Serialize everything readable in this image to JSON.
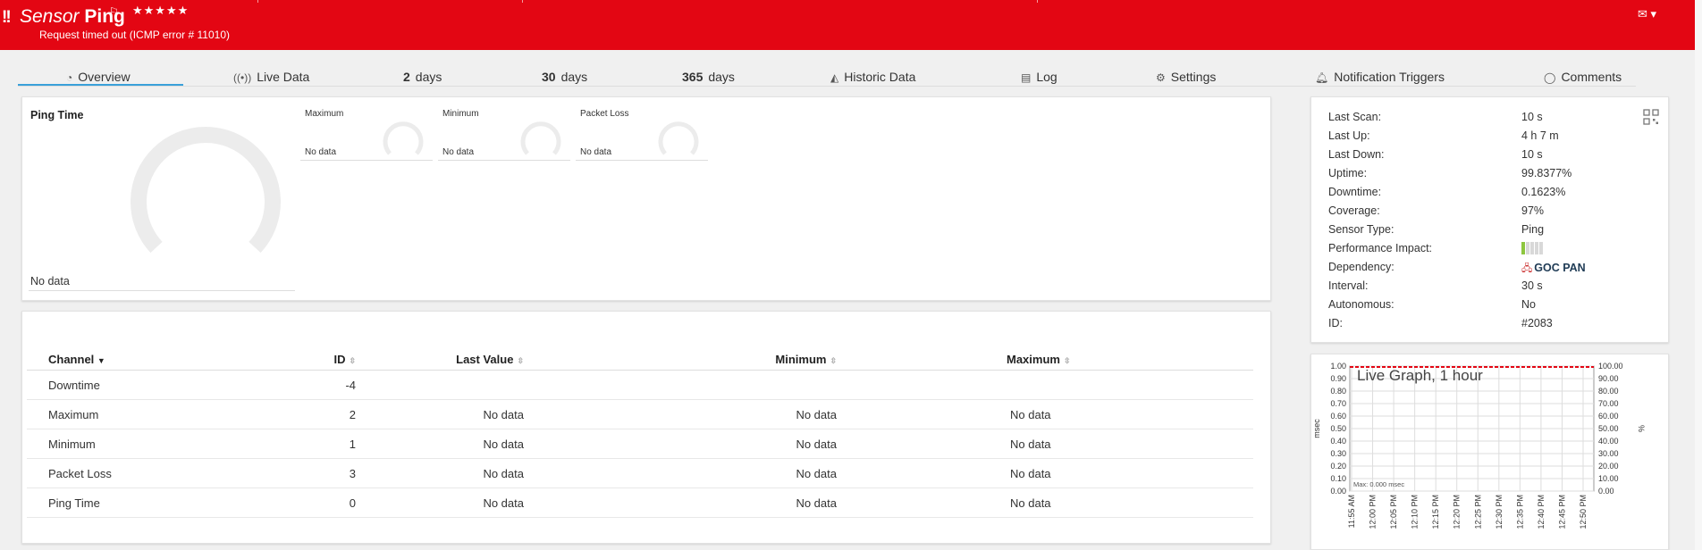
{
  "header": {
    "sensor_word": "Sensor",
    "name": "Ping",
    "stars": "★★★★★",
    "status_message": "Request timed out (ICMP error # 11010)",
    "mail_icon": "envelope-icon",
    "bg_color": "#e30613"
  },
  "tabs": [
    {
      "icon": "gauge-icon",
      "label": "Overview",
      "active": true
    },
    {
      "icon": "broadcast-icon",
      "label": "Live Data"
    },
    {
      "number": "2",
      "label": "days"
    },
    {
      "number": "30",
      "label": "days"
    },
    {
      "number": "365",
      "label": "days"
    },
    {
      "icon": "area-chart-icon",
      "label": "Historic Data"
    },
    {
      "icon": "log-icon",
      "label": "Log"
    },
    {
      "icon": "gear-icon",
      "label": "Settings"
    },
    {
      "icon": "bell-icon",
      "label": "Notification Triggers"
    },
    {
      "icon": "comment-icon",
      "label": "Comments"
    }
  ],
  "gauges": {
    "main": {
      "title": "Ping Time",
      "value": "No data"
    },
    "small": [
      {
        "title": "Maximum",
        "value": "No data"
      },
      {
        "title": "Minimum",
        "value": "No data"
      },
      {
        "title": "Packet Loss",
        "value": "No data"
      }
    ]
  },
  "channels": {
    "columns": [
      "Channel",
      "ID",
      "Last Value",
      "Minimum",
      "Maximum"
    ],
    "rows": [
      {
        "channel": "Downtime",
        "id": "-4",
        "last": "",
        "min": "",
        "max": ""
      },
      {
        "channel": "Maximum",
        "id": "2",
        "last": "No data",
        "min": "No data",
        "max": "No data"
      },
      {
        "channel": "Minimum",
        "id": "1",
        "last": "No data",
        "min": "No data",
        "max": "No data"
      },
      {
        "channel": "Packet Loss",
        "id": "3",
        "last": "No data",
        "min": "No data",
        "max": "No data"
      },
      {
        "channel": "Ping Time",
        "id": "0",
        "last": "No data",
        "min": "No data",
        "max": "No data"
      }
    ]
  },
  "info": {
    "rows": [
      {
        "label": "Last Scan:",
        "value": "10 s"
      },
      {
        "label": "Last Up:",
        "value": "4 h 7 m"
      },
      {
        "label": "Last Down:",
        "value": "10 s"
      },
      {
        "label": "Uptime:",
        "value": "99.8377%"
      },
      {
        "label": "Downtime:",
        "value": "0.1623%"
      },
      {
        "label": "Coverage:",
        "value": "97%"
      },
      {
        "label": "Sensor Type:",
        "value": "Ping"
      },
      {
        "label": "Performance Impact:",
        "value": ""
      },
      {
        "label": "Dependency:",
        "value": "GOC PAN"
      },
      {
        "label": "Interval:",
        "value": "30 s"
      },
      {
        "label": "Autonomous:",
        "value": "No"
      },
      {
        "label": "ID:",
        "value": "#2083"
      }
    ],
    "performance_impact_level": 0.2,
    "qr_icon": "qr-code-icon",
    "dependency_icon": "network-device-icon"
  },
  "live_graph": {
    "title": "Live Graph, 1 hour",
    "max_label": "Max: 0.000 msec",
    "left_unit": "msec",
    "right_unit": "%",
    "left_ticks": [
      "1.00",
      "0.90",
      "0.80",
      "0.70",
      "0.60",
      "0.50",
      "0.40",
      "0.30",
      "0.20",
      "0.10",
      "0.00"
    ],
    "right_ticks": [
      "100.00",
      "90.00",
      "80.00",
      "70.00",
      "60.00",
      "50.00",
      "40.00",
      "30.00",
      "20.00",
      "10.00",
      "0.00"
    ],
    "x_ticks": [
      "11:55 AM",
      "12:00 PM",
      "12:05 PM",
      "12:10 PM",
      "12:15 PM",
      "12:20 PM",
      "12:25 PM",
      "12:30 PM",
      "12:35 PM",
      "12:40 PM",
      "12:45 PM",
      "12:50 PM"
    ],
    "downtime_color": "#e30613"
  }
}
